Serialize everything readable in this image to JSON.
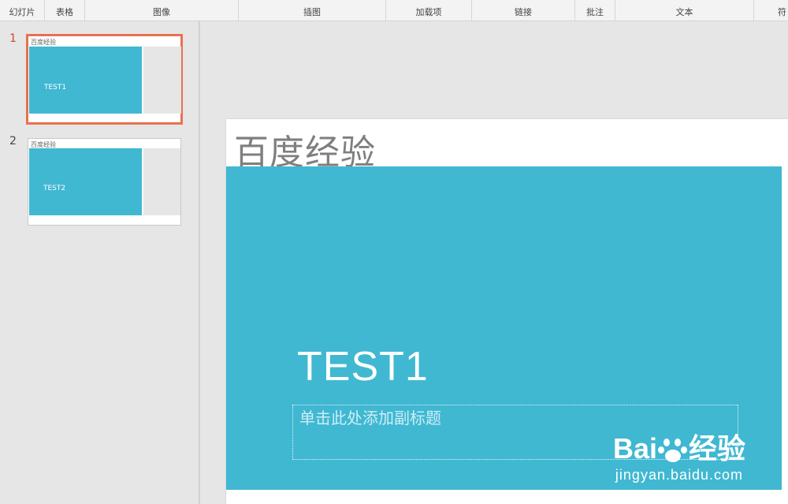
{
  "ribbon": {
    "groups": [
      {
        "label": "幻灯片"
      },
      {
        "label": "表格"
      },
      {
        "label": "图像"
      },
      {
        "label": "插图"
      },
      {
        "label": "加载项"
      },
      {
        "label": "链接"
      },
      {
        "label": "批注"
      },
      {
        "label": "文本"
      },
      {
        "label": "符"
      }
    ]
  },
  "thumbnails": [
    {
      "number": "1",
      "title": "百度经验",
      "text": "TEST1",
      "selected": true
    },
    {
      "number": "2",
      "title": "百度经验",
      "text": "TEST2",
      "selected": false
    }
  ],
  "slide": {
    "title": "百度经验",
    "heading": "TEST1",
    "subtitle_placeholder": "单击此处添加副标题"
  },
  "watermark": {
    "logo_left": "Bai",
    "logo_right": "经验",
    "url": "jingyan.baidu.com"
  },
  "colors": {
    "accent": "#40b8d2",
    "selection": "#e8714e"
  }
}
